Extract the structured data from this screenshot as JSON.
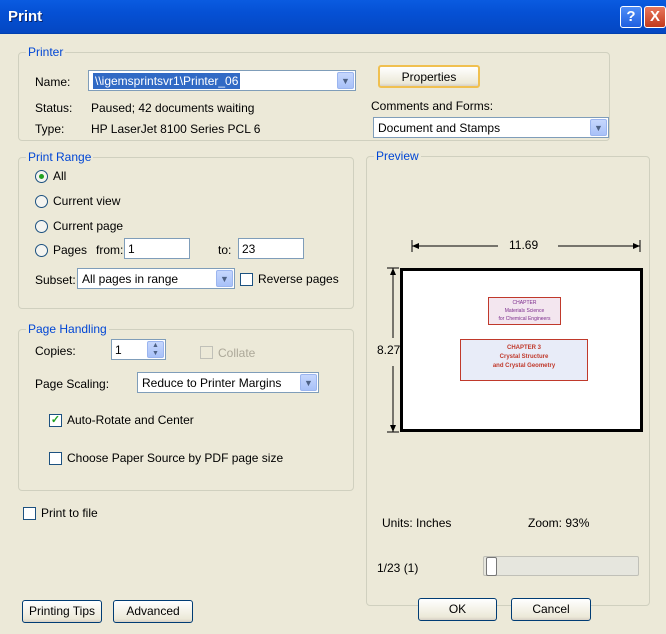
{
  "window": {
    "title": "Print",
    "help_label": "?",
    "close_label": "X"
  },
  "printer": {
    "legend": "Printer",
    "name_label": "Name:",
    "name_value": "\\\\igemsprintsvr1\\Printer_06",
    "status_label": "Status:",
    "status_value": "Paused; 42 documents waiting",
    "type_label": "Type:",
    "type_value": "HP LaserJet 8100 Series PCL 6",
    "properties_label": "Properties",
    "comments_label": "Comments and Forms:",
    "comments_value": "Document and Stamps"
  },
  "print_range": {
    "legend": "Print Range",
    "all_label": "All",
    "current_view_label": "Current view",
    "current_page_label": "Current page",
    "pages_label": "Pages",
    "from_label": "from:",
    "from_value": "1",
    "to_label": "to:",
    "to_value": "23",
    "subset_label": "Subset:",
    "subset_value": "All pages in range",
    "reverse_label": "Reverse pages"
  },
  "page_handling": {
    "legend": "Page Handling",
    "copies_label": "Copies:",
    "copies_value": "1",
    "collate_label": "Collate",
    "scaling_label": "Page Scaling:",
    "scaling_value": "Reduce to Printer Margins",
    "autorotate_label": "Auto-Rotate and Center",
    "paper_source_label": "Choose Paper Source by PDF page size"
  },
  "print_to_file_label": "Print to file",
  "preview": {
    "legend": "Preview",
    "width_value": "11.69",
    "height_value": "8.27",
    "doc_box1_lines": [
      "CHAPTER",
      "Materials Science",
      "for Chemical Engineers"
    ],
    "doc_box2_lines": [
      "CHAPTER 3",
      "Crystal Structure",
      "and Crystal Geometry"
    ],
    "units_label": "Units: Inches",
    "zoom_label": "Zoom:  93%",
    "page_indicator": "1/23 (1)",
    "slider_fraction": 0
  },
  "buttons": {
    "tips_label": "Printing Tips",
    "advanced_label": "Advanced",
    "ok_label": "OK",
    "cancel_label": "Cancel"
  }
}
